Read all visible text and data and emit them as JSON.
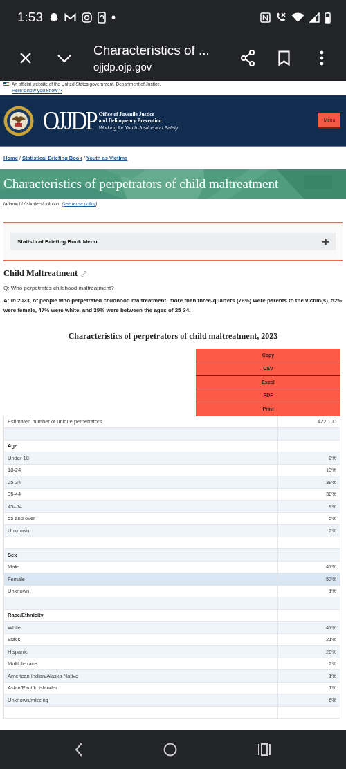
{
  "status_bar": {
    "time": "1:53"
  },
  "browser_toolbar": {
    "title": "Characteristics of ...",
    "url": "ojjdp.ojp.gov"
  },
  "gov_banner": {
    "text": "An official website of the United States government, Department of Justice.",
    "link": "Here's how you know"
  },
  "header": {
    "logo_mark": "OJJDP",
    "logo_name_lines": [
      "Office of Juvenile Justice",
      "and Delinquency Prevention"
    ],
    "tagline": "Working for Youth Justice and Safety",
    "menu_button": "Menu"
  },
  "breadcrumbs": {
    "separator": "/",
    "items": [
      "Home",
      "Statistical Briefing Book",
      "Youth as Victims"
    ]
  },
  "hero": {
    "title": "Characteristics of perpetrators of child maltreatment"
  },
  "image_credit": {
    "text": "tadamichi / shutterstock.com (",
    "link": "see reuse policy",
    "after": ")."
  },
  "section_menu": {
    "label": "Statistical Briefing Book Menu",
    "expanded": false
  },
  "section": {
    "heading": "Child Maltreatment",
    "question": "Q: Who perpetrates childhood maltreatment?",
    "answer": "A: In 2023, of people who perpetrated childhood maltreatment, more than three-quarters (76%) were parents to the victim(s), 52% were female, 47% were white, and 39% were between the ages of 25-34."
  },
  "table": {
    "title": "Characteristics of perpetrators of child maltreatment, 2023",
    "export_buttons": [
      "Copy",
      "CSV",
      "Excel",
      "PDF",
      "Print"
    ],
    "rows": [
      {
        "kind": "data",
        "label": "Estimated number of unique perpetrators",
        "value": "422,100",
        "selected": false
      },
      {
        "kind": "blank",
        "selected": false
      },
      {
        "kind": "heading",
        "label": "Age",
        "selected": false
      },
      {
        "kind": "data",
        "label": "Under 18",
        "value": "2%",
        "selected": false
      },
      {
        "kind": "data",
        "label": "18-24",
        "value": "13%",
        "selected": false
      },
      {
        "kind": "data",
        "label": "25-34",
        "value": "39%",
        "selected": false
      },
      {
        "kind": "data",
        "label": "35-44",
        "value": "30%",
        "selected": false
      },
      {
        "kind": "data",
        "label": "45–54",
        "value": "9%",
        "selected": false
      },
      {
        "kind": "data",
        "label": "55 and over",
        "value": "5%",
        "selected": false
      },
      {
        "kind": "data",
        "label": "Unknown",
        "value": "2%",
        "selected": false
      },
      {
        "kind": "blank",
        "selected": false
      },
      {
        "kind": "heading",
        "label": "Sex",
        "selected": false
      },
      {
        "kind": "data",
        "label": "Male",
        "value": "47%",
        "selected": false
      },
      {
        "kind": "data",
        "label": "Female",
        "value": "52%",
        "selected": true
      },
      {
        "kind": "data",
        "label": "Unknown",
        "value": "1%",
        "selected": false
      },
      {
        "kind": "blank",
        "selected": false
      },
      {
        "kind": "heading",
        "label": "Race/Ethnicity",
        "selected": false
      },
      {
        "kind": "data",
        "label": "White",
        "value": "47%",
        "selected": false
      },
      {
        "kind": "data",
        "label": "Black",
        "value": "21%",
        "selected": false
      },
      {
        "kind": "data",
        "label": "Hispanic",
        "value": "20%",
        "selected": false
      },
      {
        "kind": "data",
        "label": "Multiple race",
        "value": "2%",
        "selected": false
      },
      {
        "kind": "data",
        "label": "American Indian/Alaska Native",
        "value": "1%",
        "selected": false
      },
      {
        "kind": "data",
        "label": "Asian/Pacific Islander",
        "value": "1%",
        "selected": false
      },
      {
        "kind": "data",
        "label": "Unknown/missing",
        "value": "6%",
        "selected": false
      },
      {
        "kind": "blank",
        "selected": false
      }
    ]
  }
}
